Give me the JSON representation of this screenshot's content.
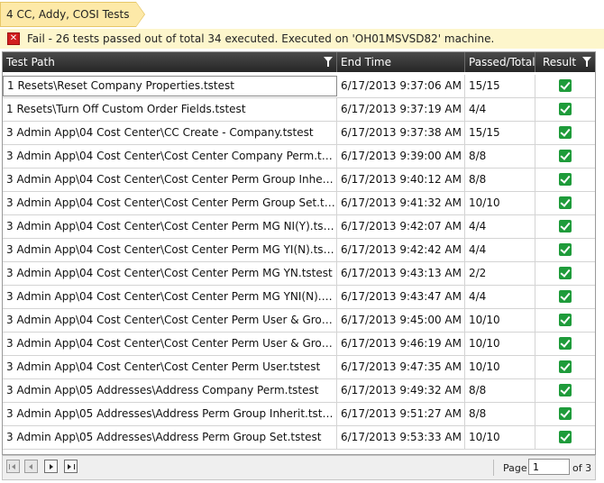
{
  "breadcrumb": {
    "label": "4 CC, Addy, COSI Tests"
  },
  "status": {
    "text": "Fail - 26 tests passed out of total 34 executed. Executed on 'OH01MSVSD82' machine."
  },
  "grid": {
    "columns": [
      {
        "label": "Test Path",
        "filter": true
      },
      {
        "label": "End Time",
        "filter": false
      },
      {
        "label": "Passed/Total",
        "filter": false
      },
      {
        "label": "Result",
        "filter": true
      }
    ],
    "rows": [
      {
        "path": "1 Resets\\Reset Company Properties.tstest",
        "end": "6/17/2013 9:37:06 AM",
        "passed": "15/15",
        "result": "pass"
      },
      {
        "path": "1 Resets\\Turn Off Custom Order Fields.tstest",
        "end": "6/17/2013 9:37:19 AM",
        "passed": "4/4",
        "result": "pass"
      },
      {
        "path": "3 Admin App\\04 Cost Center\\CC Create - Company.tstest",
        "end": "6/17/2013 9:37:38 AM",
        "passed": "15/15",
        "result": "pass"
      },
      {
        "path": "3 Admin App\\04 Cost Center\\Cost Center Company Perm.tstest",
        "end": "6/17/2013 9:39:00 AM",
        "passed": "8/8",
        "result": "pass"
      },
      {
        "path": "3 Admin App\\04 Cost Center\\Cost Center Perm Group Inhert.tstest",
        "end": "6/17/2013 9:40:12 AM",
        "passed": "8/8",
        "result": "pass"
      },
      {
        "path": "3 Admin App\\04 Cost Center\\Cost Center Perm Group Set.tstest",
        "end": "6/17/2013 9:41:32 AM",
        "passed": "10/10",
        "result": "pass"
      },
      {
        "path": "3 Admin App\\04 Cost Center\\Cost Center Perm MG NI(Y).tstest",
        "end": "6/17/2013 9:42:07 AM",
        "passed": "4/4",
        "result": "pass"
      },
      {
        "path": "3 Admin App\\04 Cost Center\\Cost Center Perm MG YI(N).tstest",
        "end": "6/17/2013 9:42:42 AM",
        "passed": "4/4",
        "result": "pass"
      },
      {
        "path": "3 Admin App\\04 Cost Center\\Cost Center Perm MG YN.tstest",
        "end": "6/17/2013 9:43:13 AM",
        "passed": "2/2",
        "result": "pass"
      },
      {
        "path": "3 Admin App\\04 Cost Center\\Cost Center Perm MG YNI(N).tstest",
        "end": "6/17/2013 9:43:47 AM",
        "passed": "4/4",
        "result": "pass"
      },
      {
        "path": "3 Admin App\\04 Cost Center\\Cost Center Perm User & Group CD.t...",
        "end": "6/17/2013 9:45:00 AM",
        "passed": "10/10",
        "result": "pass"
      },
      {
        "path": "3 Admin App\\04 Cost Center\\Cost Center Perm User & Group.tstest",
        "end": "6/17/2013 9:46:19 AM",
        "passed": "10/10",
        "result": "pass"
      },
      {
        "path": "3 Admin App\\04 Cost Center\\Cost Center Perm User.tstest",
        "end": "6/17/2013 9:47:35 AM",
        "passed": "10/10",
        "result": "pass"
      },
      {
        "path": "3 Admin App\\05 Addresses\\Address Company Perm.tstest",
        "end": "6/17/2013 9:49:32 AM",
        "passed": "8/8",
        "result": "pass"
      },
      {
        "path": "3 Admin App\\05 Addresses\\Address Perm Group Inherit.tstest",
        "end": "6/17/2013 9:51:27 AM",
        "passed": "8/8",
        "result": "pass"
      },
      {
        "path": "3 Admin App\\05 Addresses\\Address Perm Group Set.tstest",
        "end": "6/17/2013 9:53:33 AM",
        "passed": "10/10",
        "result": "pass"
      }
    ]
  },
  "pager": {
    "page_label": "Page",
    "page_value": "1",
    "of_label": "of 3"
  },
  "colors": {
    "header_bg": "#2e2e2e",
    "pass_green": "#1e9b3a",
    "fail_red": "#d21f1f",
    "breadcrumb_bg": "#fde9a8",
    "status_bg": "#fdf6cc"
  }
}
